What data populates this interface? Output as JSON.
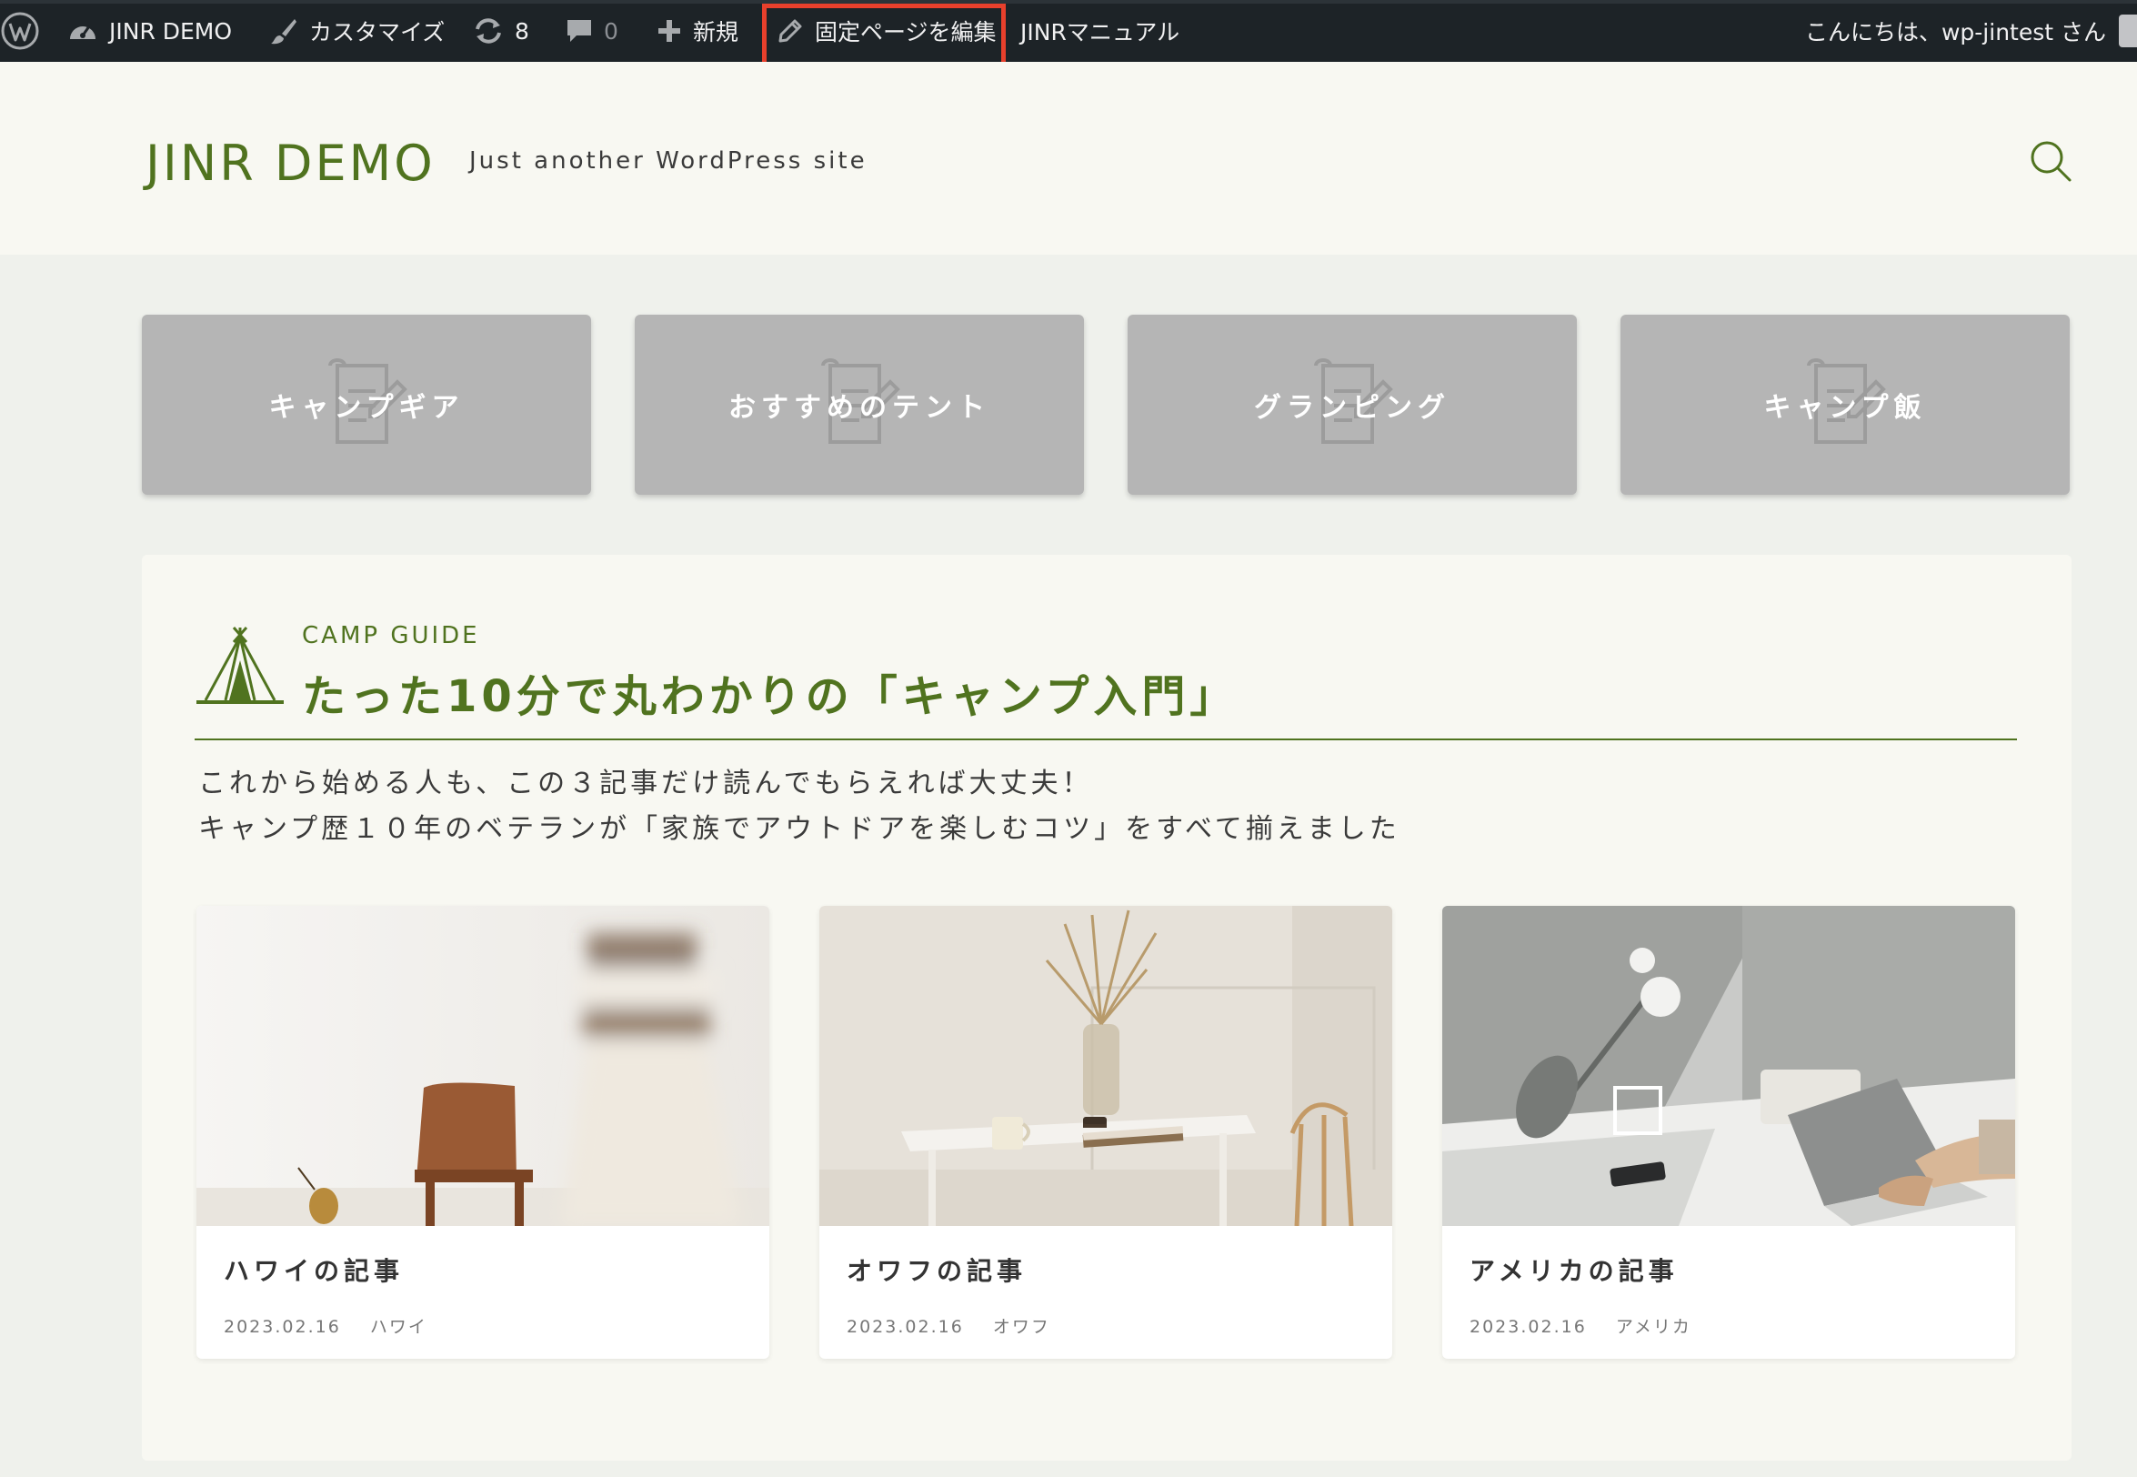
{
  "admin_bar": {
    "site_name": "JINR DEMO",
    "customize": "カスタマイズ",
    "updates_count": "8",
    "comments_count": "0",
    "new": "新規",
    "edit_page": "固定ページを編集",
    "manual": "JINRマニュアル",
    "greeting": "こんにちは、wp-jintest さん"
  },
  "header": {
    "title": "JINR DEMO",
    "tagline": "Just another WordPress site"
  },
  "categories": [
    {
      "label": "キャンプギア"
    },
    {
      "label": "おすすめのテント"
    },
    {
      "label": "グランピング"
    },
    {
      "label": "キャンプ飯"
    }
  ],
  "guide": {
    "kicker": "CAMP GUIDE",
    "heading": "たった10分で丸わかりの「キャンプ入門」",
    "desc_line1": "これから始める人も、この３記事だけ読んでもらえれば大丈夫！",
    "desc_line2": "キャンプ歴１０年のベテランが「家族でアウトドアを楽しむコツ」をすべて揃えました"
  },
  "articles": [
    {
      "title": "ハワイの記事",
      "date": "2023.02.16",
      "category": "ハワイ"
    },
    {
      "title": "オワフの記事",
      "date": "2023.02.16",
      "category": "オワフ"
    },
    {
      "title": "アメリカの記事",
      "date": "2023.02.16",
      "category": "アメリカ"
    }
  ],
  "colors": {
    "admin_bar_bg": "#1d2327",
    "brand_green": "#50731f",
    "header_bg": "#f8f8f2",
    "page_bg": "#eff1ec",
    "category_card_bg": "#b5b5b5",
    "highlight_red": "#e8402c"
  },
  "icons": {
    "admin_bar": [
      "wordpress-logo-icon",
      "dashboard-icon",
      "paintbrush-icon",
      "updates-icon",
      "comment-icon",
      "plus-icon",
      "pencil-icon"
    ],
    "header": "search-icon",
    "category_card": "document-pencil-icon",
    "guide": "tent-icon"
  }
}
